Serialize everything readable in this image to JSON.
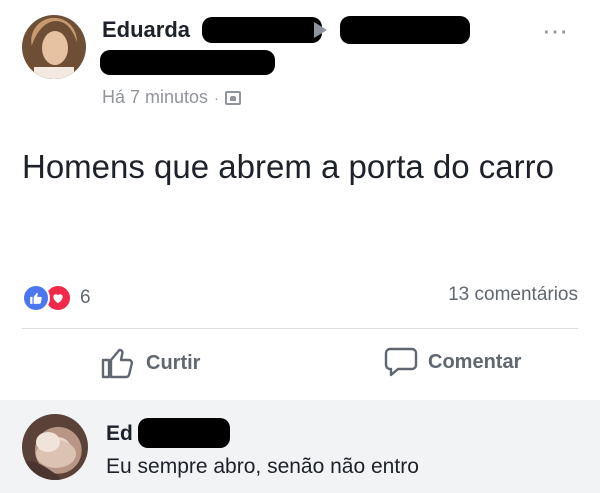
{
  "post": {
    "author_name": "Eduarda",
    "timestamp": "Há 7 minutos",
    "separator": "·",
    "audience_icon": "group-audience-icon",
    "more_icon": "more-options-icon",
    "text": "Homens que abrem a porta do carro"
  },
  "reactions": {
    "count": "6",
    "icons": [
      "like-icon",
      "love-icon"
    ],
    "like_color": "#4a76f0",
    "love_color": "#f0284a"
  },
  "comments_summary": "13 comentários",
  "actions": {
    "like_label": "Curtir",
    "comment_label": "Comentar"
  },
  "comment": {
    "author_name": "Ed",
    "text": "Eu sempre abro, senão não entro"
  }
}
